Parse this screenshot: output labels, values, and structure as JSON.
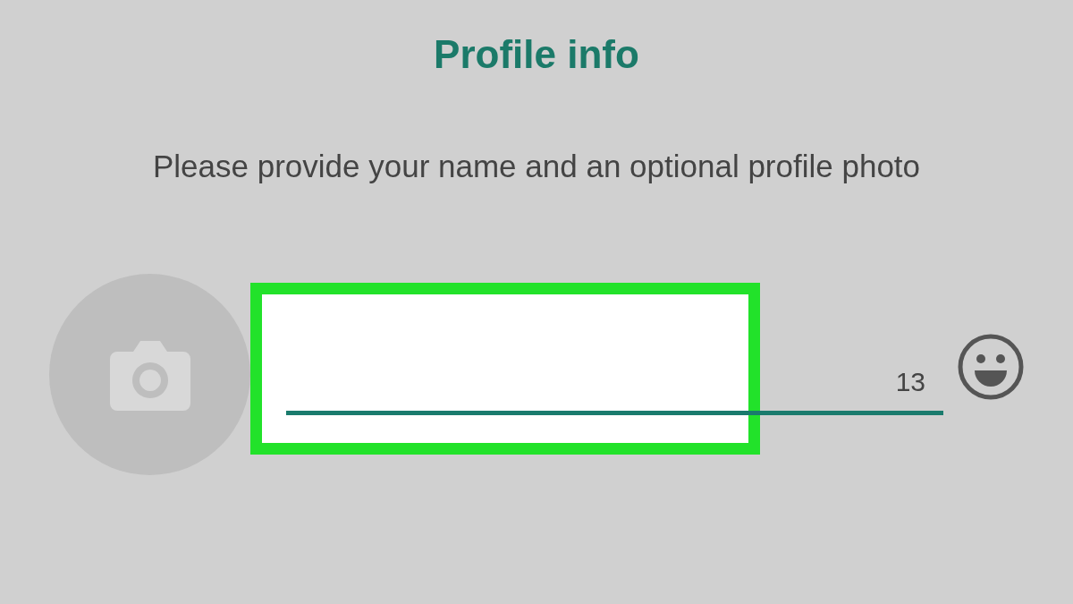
{
  "title": "Profile info",
  "subtitle": "Please provide your name and an optional profile photo",
  "name_field": {
    "highlighted": true,
    "counter": "13"
  }
}
